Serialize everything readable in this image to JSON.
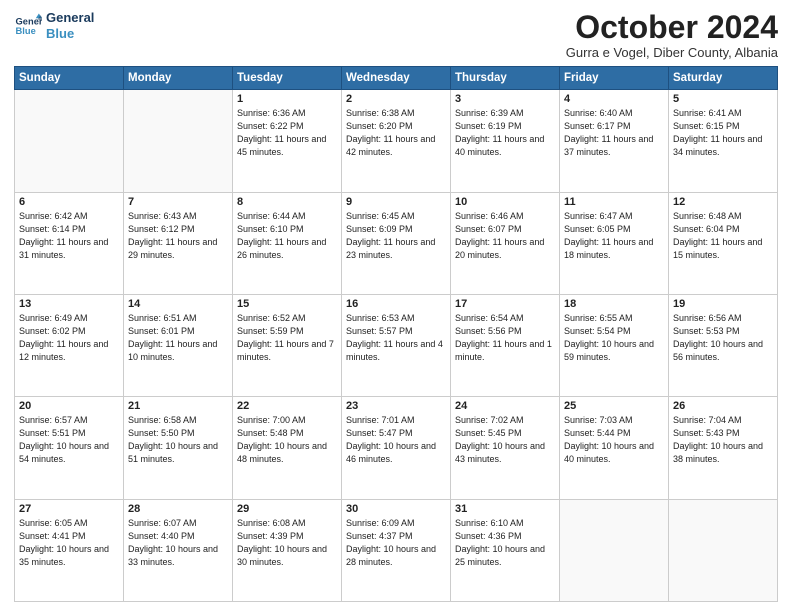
{
  "header": {
    "logo_line1": "General",
    "logo_line2": "Blue",
    "month_title": "October 2024",
    "location": "Gurra e Vogel, Diber County, Albania"
  },
  "weekdays": [
    "Sunday",
    "Monday",
    "Tuesday",
    "Wednesday",
    "Thursday",
    "Friday",
    "Saturday"
  ],
  "weeks": [
    [
      {
        "day": "",
        "info": ""
      },
      {
        "day": "",
        "info": ""
      },
      {
        "day": "1",
        "info": "Sunrise: 6:36 AM\nSunset: 6:22 PM\nDaylight: 11 hours and 45 minutes."
      },
      {
        "day": "2",
        "info": "Sunrise: 6:38 AM\nSunset: 6:20 PM\nDaylight: 11 hours and 42 minutes."
      },
      {
        "day": "3",
        "info": "Sunrise: 6:39 AM\nSunset: 6:19 PM\nDaylight: 11 hours and 40 minutes."
      },
      {
        "day": "4",
        "info": "Sunrise: 6:40 AM\nSunset: 6:17 PM\nDaylight: 11 hours and 37 minutes."
      },
      {
        "day": "5",
        "info": "Sunrise: 6:41 AM\nSunset: 6:15 PM\nDaylight: 11 hours and 34 minutes."
      }
    ],
    [
      {
        "day": "6",
        "info": "Sunrise: 6:42 AM\nSunset: 6:14 PM\nDaylight: 11 hours and 31 minutes."
      },
      {
        "day": "7",
        "info": "Sunrise: 6:43 AM\nSunset: 6:12 PM\nDaylight: 11 hours and 29 minutes."
      },
      {
        "day": "8",
        "info": "Sunrise: 6:44 AM\nSunset: 6:10 PM\nDaylight: 11 hours and 26 minutes."
      },
      {
        "day": "9",
        "info": "Sunrise: 6:45 AM\nSunset: 6:09 PM\nDaylight: 11 hours and 23 minutes."
      },
      {
        "day": "10",
        "info": "Sunrise: 6:46 AM\nSunset: 6:07 PM\nDaylight: 11 hours and 20 minutes."
      },
      {
        "day": "11",
        "info": "Sunrise: 6:47 AM\nSunset: 6:05 PM\nDaylight: 11 hours and 18 minutes."
      },
      {
        "day": "12",
        "info": "Sunrise: 6:48 AM\nSunset: 6:04 PM\nDaylight: 11 hours and 15 minutes."
      }
    ],
    [
      {
        "day": "13",
        "info": "Sunrise: 6:49 AM\nSunset: 6:02 PM\nDaylight: 11 hours and 12 minutes."
      },
      {
        "day": "14",
        "info": "Sunrise: 6:51 AM\nSunset: 6:01 PM\nDaylight: 11 hours and 10 minutes."
      },
      {
        "day": "15",
        "info": "Sunrise: 6:52 AM\nSunset: 5:59 PM\nDaylight: 11 hours and 7 minutes."
      },
      {
        "day": "16",
        "info": "Sunrise: 6:53 AM\nSunset: 5:57 PM\nDaylight: 11 hours and 4 minutes."
      },
      {
        "day": "17",
        "info": "Sunrise: 6:54 AM\nSunset: 5:56 PM\nDaylight: 11 hours and 1 minute."
      },
      {
        "day": "18",
        "info": "Sunrise: 6:55 AM\nSunset: 5:54 PM\nDaylight: 10 hours and 59 minutes."
      },
      {
        "day": "19",
        "info": "Sunrise: 6:56 AM\nSunset: 5:53 PM\nDaylight: 10 hours and 56 minutes."
      }
    ],
    [
      {
        "day": "20",
        "info": "Sunrise: 6:57 AM\nSunset: 5:51 PM\nDaylight: 10 hours and 54 minutes."
      },
      {
        "day": "21",
        "info": "Sunrise: 6:58 AM\nSunset: 5:50 PM\nDaylight: 10 hours and 51 minutes."
      },
      {
        "day": "22",
        "info": "Sunrise: 7:00 AM\nSunset: 5:48 PM\nDaylight: 10 hours and 48 minutes."
      },
      {
        "day": "23",
        "info": "Sunrise: 7:01 AM\nSunset: 5:47 PM\nDaylight: 10 hours and 46 minutes."
      },
      {
        "day": "24",
        "info": "Sunrise: 7:02 AM\nSunset: 5:45 PM\nDaylight: 10 hours and 43 minutes."
      },
      {
        "day": "25",
        "info": "Sunrise: 7:03 AM\nSunset: 5:44 PM\nDaylight: 10 hours and 40 minutes."
      },
      {
        "day": "26",
        "info": "Sunrise: 7:04 AM\nSunset: 5:43 PM\nDaylight: 10 hours and 38 minutes."
      }
    ],
    [
      {
        "day": "27",
        "info": "Sunrise: 6:05 AM\nSunset: 4:41 PM\nDaylight: 10 hours and 35 minutes."
      },
      {
        "day": "28",
        "info": "Sunrise: 6:07 AM\nSunset: 4:40 PM\nDaylight: 10 hours and 33 minutes."
      },
      {
        "day": "29",
        "info": "Sunrise: 6:08 AM\nSunset: 4:39 PM\nDaylight: 10 hours and 30 minutes."
      },
      {
        "day": "30",
        "info": "Sunrise: 6:09 AM\nSunset: 4:37 PM\nDaylight: 10 hours and 28 minutes."
      },
      {
        "day": "31",
        "info": "Sunrise: 6:10 AM\nSunset: 4:36 PM\nDaylight: 10 hours and 25 minutes."
      },
      {
        "day": "",
        "info": ""
      },
      {
        "day": "",
        "info": ""
      }
    ]
  ]
}
